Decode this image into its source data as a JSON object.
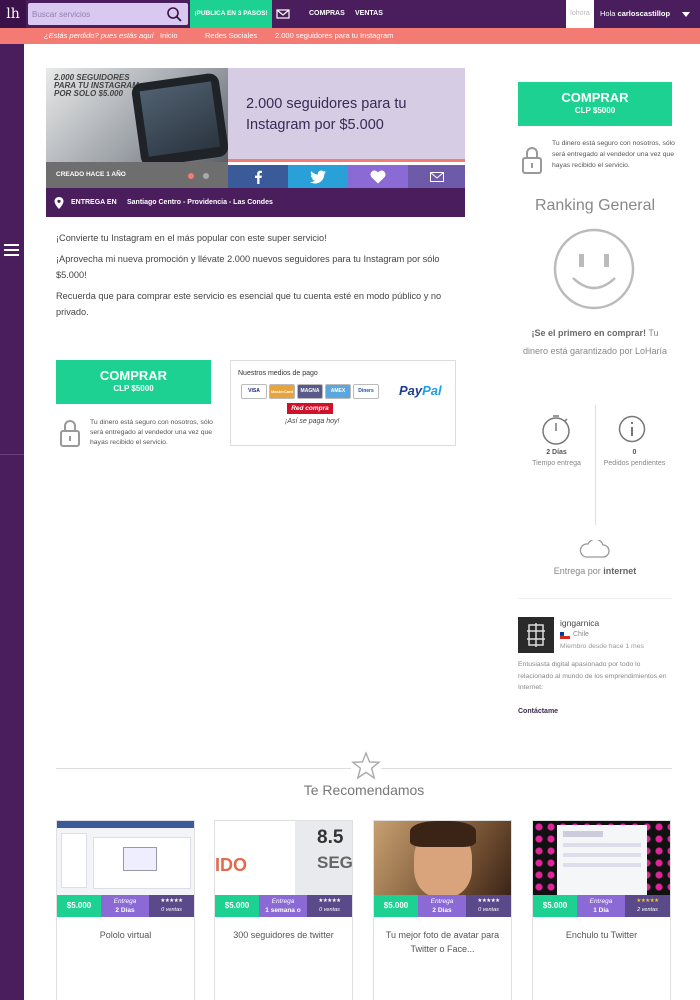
{
  "topbar": {
    "logo": "lh",
    "search_placeholder": "Buscar servicios",
    "publish_label": "¡PUBLICA EN 3 PASOS!",
    "nav": [
      "COMPRAS",
      "VENTAS"
    ],
    "user_box": "lohora",
    "greeting": "Hola",
    "username": "carloscastillop"
  },
  "breadcrumb": {
    "question": "¿Estás perdido? pues estás aquí",
    "items": [
      "Inicio",
      "Redes Sociales",
      "2.000 seguidores para tu Instagram"
    ]
  },
  "hero": {
    "image_text": "2.000 SEGUIDORES PARA TU INSTAGRAM POR SOLO $5.000",
    "title": "2.000 seguidores para tu Instagram por $5.000",
    "created_prefix": "CREADO HACE",
    "created_value": "1 AÑO",
    "delivery_label": "ENTREGA EN",
    "delivery_places": "Santiago Centro - Providencia - Las Condes"
  },
  "description": [
    "¡Convierte tu Instagram en el más popular con este super servicio!",
    "¡Aprovecha mi nueva promoción y llévate 2.000 nuevos seguidores para tu Instagram por sólo $5.000!",
    "Recuerda que para comprar este servicio es esencial que tu cuenta esté en modo público y no privado."
  ],
  "buy": {
    "label": "COMPRAR",
    "price": "CLP $5000",
    "secure_text": "Tu dinero está seguro con nosotros, sólo será entregado al vendedor una vez que hayas recibido el servicio."
  },
  "payment": {
    "title": "Nuestros medios de pago",
    "cards": [
      "VISA",
      "MasterCard",
      "MAGNA",
      "AMEX",
      "Diners"
    ],
    "paypal_a": "Pay",
    "paypal_b": "Pal",
    "redcompra": "Red compra",
    "tagline": "¡Así se paga hoy!"
  },
  "ranking": {
    "title": "Ranking General",
    "first_bold": "¡Se el primero en comprar!",
    "first_rest": "Tu dinero está garantizado por LoHaría",
    "time_value": "2 Días",
    "time_label": "Tiempo entrega",
    "pending_value": "0",
    "pending_label": "Pedidos pendientes",
    "delivery_prefix": "Entrega por",
    "delivery_mode": "internet"
  },
  "seller": {
    "name": "igngarnica",
    "country": "Chile",
    "since": "Miembro desde hace 1 mes",
    "bio": "Entusiasta digital apasionado por todo lo relacionado al mundo de los emprendimientos en Internet.",
    "contact": "Contáctame"
  },
  "recommendations": {
    "title": "Te Recomendamos",
    "items": [
      {
        "title": "Pololo virtual",
        "price": "$5.000",
        "delivery_label": "Entrega",
        "delivery_value": "2 Días",
        "stars": "★★★★★",
        "sales": "0 ventas"
      },
      {
        "title": "300 seguidores de twitter",
        "price": "$5.000",
        "delivery_label": "Entrega",
        "delivery_value": "1 semana o",
        "stars": "★★★★★",
        "sales": "0 ventas",
        "image_text_a": "8.5",
        "image_text_b": "SEG",
        "image_text_c": "IDO"
      },
      {
        "title": "Tu mejor foto de avatar para Twitter o Face...",
        "price": "$5.000",
        "delivery_label": "Entrega",
        "delivery_value": "2 Días",
        "stars": "★★★★★",
        "sales": "0 ventas"
      },
      {
        "title": "Enchulo tu Twitter",
        "price": "$5.000",
        "delivery_label": "Entrega",
        "delivery_value": "1 Día",
        "stars": "★★★★★",
        "sales": "2 ventas"
      }
    ]
  },
  "colors": {
    "brand_purple": "#4a1d5c",
    "green": "#1dd193",
    "coral": "#f47b73",
    "lavender": "#d6cce4"
  }
}
